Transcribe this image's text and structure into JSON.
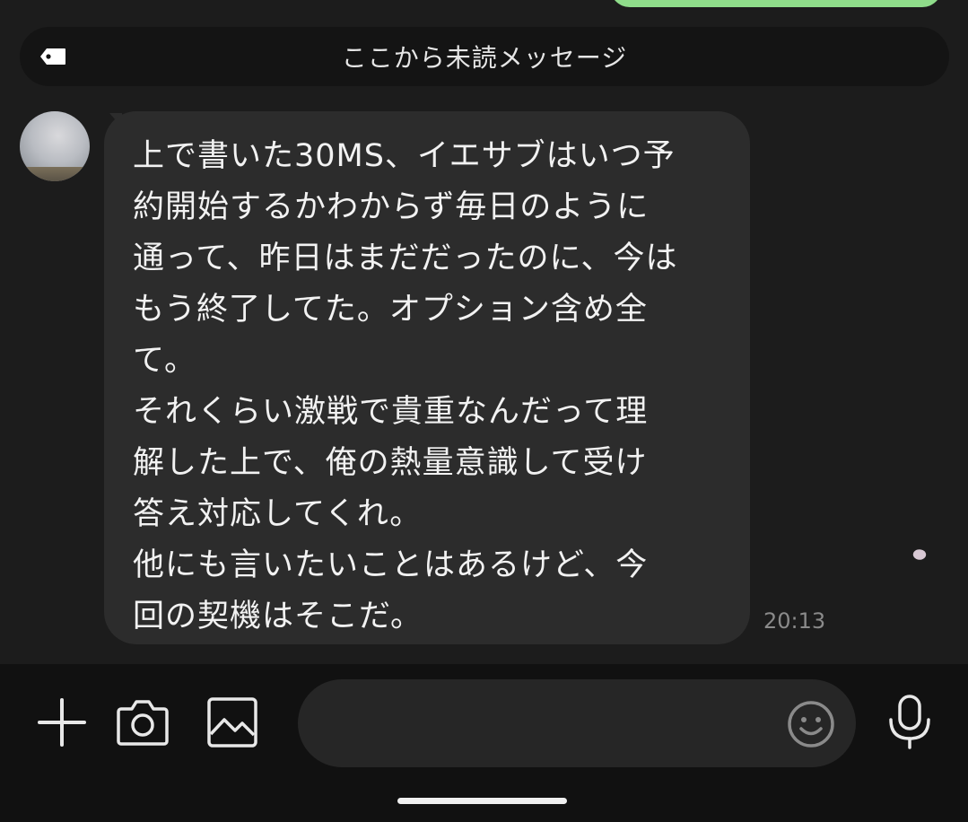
{
  "unread_divider": {
    "label": "ここから未読メッセージ",
    "icon": "tag-icon"
  },
  "message": {
    "lines": [
      "上で書いた30MS、イエサブはいつ予",
      "約開始するかわからず毎日のように",
      "通って、昨日はまだだったのに、今は",
      "もう終了してた。オプション含め全",
      "て。",
      "それくらい激戦で貴重なんだって理",
      "解した上で、俺の熱量意識して受け",
      "答え対応してくれ。",
      "他にも言いたいことはあるけど、今",
      "回の契機はそこだ。"
    ],
    "time": "20:13"
  },
  "input_bar": {
    "icons": [
      "plus-icon",
      "camera-icon",
      "image-icon",
      "emoji-icon",
      "microphone-icon"
    ],
    "text_value": ""
  },
  "colors": {
    "background": "#1c1c1c",
    "bubble": "#2c2c2c",
    "outgoing_bubble": "#8fdc8a",
    "input_bar": "#111111"
  }
}
